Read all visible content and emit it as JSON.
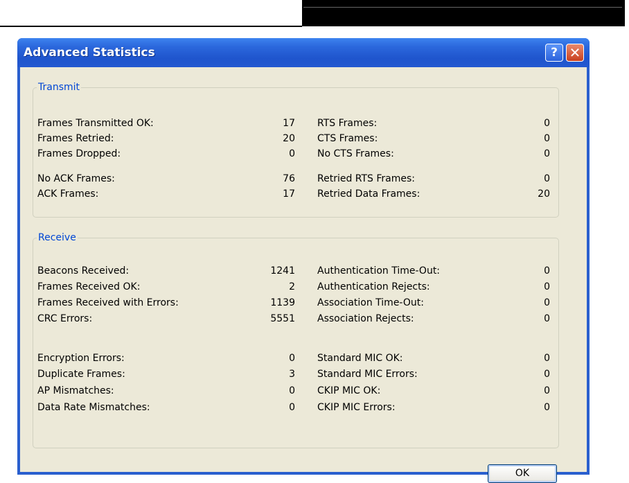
{
  "window": {
    "title": "Advanced Statistics"
  },
  "transmit": {
    "legend": "Transmit",
    "left": [
      {
        "label": "Frames Transmitted OK:",
        "value": "17"
      },
      {
        "label": "Frames Retried:",
        "value": "20"
      },
      {
        "label": "Frames Dropped:",
        "value": "0"
      },
      {
        "label": "No ACK Frames:",
        "value": "76"
      },
      {
        "label": "ACK Frames:",
        "value": "17"
      }
    ],
    "right": [
      {
        "label": "RTS Frames:",
        "value": "0"
      },
      {
        "label": "CTS Frames:",
        "value": "0"
      },
      {
        "label": "No CTS Frames:",
        "value": "0"
      },
      {
        "label": "Retried RTS Frames:",
        "value": "0"
      },
      {
        "label": "Retried Data Frames:",
        "value": "20"
      }
    ]
  },
  "receive": {
    "legend": "Receive",
    "left": [
      {
        "label": "Beacons Received:",
        "value": "1241"
      },
      {
        "label": "Frames Received OK:",
        "value": "2"
      },
      {
        "label": "Frames Received with Errors:",
        "value": "1139"
      },
      {
        "label": "CRC Errors:",
        "value": "5551"
      },
      {
        "label": "Encryption Errors:",
        "value": "0"
      },
      {
        "label": "Duplicate Frames:",
        "value": "3"
      },
      {
        "label": "AP Mismatches:",
        "value": "0"
      },
      {
        "label": "Data Rate Mismatches:",
        "value": "0"
      }
    ],
    "right": [
      {
        "label": "Authentication Time-Out:",
        "value": "0"
      },
      {
        "label": "Authentication Rejects:",
        "value": "0"
      },
      {
        "label": "Association Time-Out:",
        "value": "0"
      },
      {
        "label": "Association Rejects:",
        "value": "0"
      },
      {
        "label": "Standard MIC OK:",
        "value": "0"
      },
      {
        "label": "Standard MIC Errors:",
        "value": "0"
      },
      {
        "label": "CKIP MIC OK:",
        "value": "0"
      },
      {
        "label": "CKIP MIC Errors:",
        "value": "0"
      }
    ]
  },
  "buttons": {
    "ok": "OK",
    "help_icon": "help-icon",
    "close_icon": "close-icon",
    "help_glyph": "?",
    "close_glyph": "✕"
  }
}
